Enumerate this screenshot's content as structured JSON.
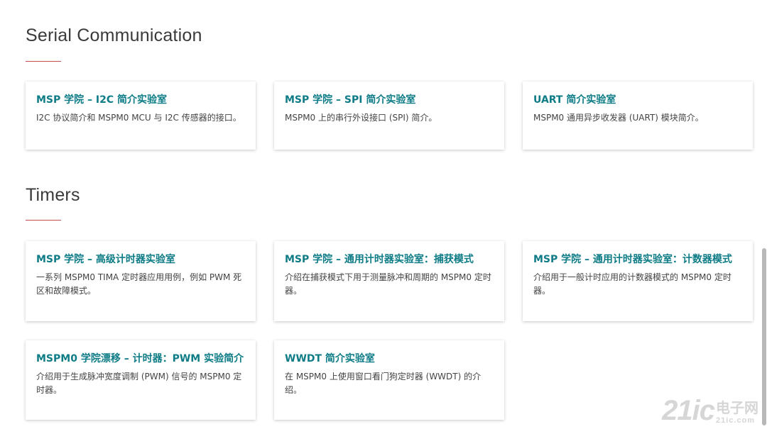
{
  "sections": [
    {
      "title": "Serial Communication",
      "cards": [
        {
          "title": "MSP 学院 – I2C 简介实验室",
          "description": "I2C 协议简介和 MSPM0 MCU 与 I2C 传感器的接口。"
        },
        {
          "title": "MSP 学院 – SPI 简介实验室",
          "description": "MSPM0 上的串行外设接口 (SPI) 简介。"
        },
        {
          "title": "UART 简介实验室",
          "description": "MSPM0 通用异步收发器 (UART) 模块简介。"
        }
      ]
    },
    {
      "title": "Timers",
      "cards": [
        {
          "title": "MSP 学院 – 高级计时器实验室",
          "description": "一系列 MSPM0 TIMA 定时器应用用例，例如 PWM 死区和故障模式。"
        },
        {
          "title": "MSP 学院 – 通用计时器实验室：捕获模式",
          "description": "介绍在捕获模式下用于测量脉冲和周期的 MSPM0 定时器。"
        },
        {
          "title": "MSP 学院 – 通用计时器实验室：计数器模式",
          "description": "介绍用于一般计时应用的计数器模式的 MSPM0 定时器。"
        },
        {
          "title": "MSPM0 学院漂移 – 计时器：PWM 实验简介",
          "description": "介绍用于生成脉冲宽度调制 (PWM) 信号的 MSPM0 定时器。"
        },
        {
          "title": "WWDT 简介实验室",
          "description": "在 MSPM0 上使用窗口看门狗定时器 (WWDT) 的介绍。"
        }
      ]
    }
  ],
  "watermark": {
    "number": "21ic",
    "brand": "电子网",
    "domain": "21ic.com"
  },
  "colors": {
    "card_title": "#0e7c86",
    "section_rule": "#c0504d",
    "section_title": "#3a3a3a"
  }
}
